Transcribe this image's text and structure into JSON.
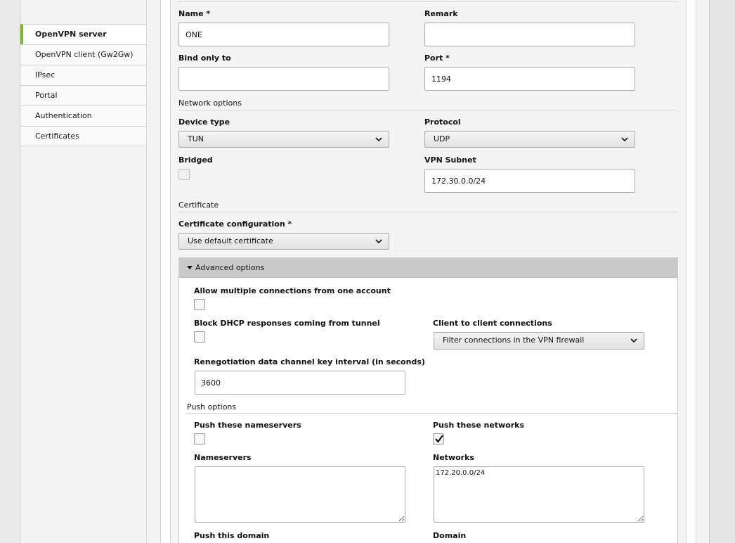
{
  "sidebar": {
    "items": [
      {
        "label": "OpenVPN server",
        "active": true
      },
      {
        "label": "OpenVPN client (Gw2Gw)",
        "active": false
      },
      {
        "label": "IPsec",
        "active": false
      },
      {
        "label": "Portal",
        "active": false
      },
      {
        "label": "Authentication",
        "active": false
      },
      {
        "label": "Certificates",
        "active": false
      }
    ]
  },
  "form": {
    "name_label": "Name *",
    "name_value": "ONE",
    "remark_label": "Remark",
    "remark_value": "",
    "bind_label": "Bind only to",
    "bind_value": "",
    "port_label": "Port *",
    "port_value": "1194",
    "network_options_title": "Network options",
    "device_type_label": "Device type",
    "device_type_value": "TUN",
    "protocol_label": "Protocol",
    "protocol_value": "UDP",
    "bridged_label": "Bridged",
    "bridged_checked": false,
    "vpn_subnet_label": "VPN Subnet",
    "vpn_subnet_value": "172.30.0.0/24",
    "certificate_title": "Certificate",
    "cert_config_label": "Certificate configuration *",
    "cert_config_value": "Use default certificate"
  },
  "advanced": {
    "title": "Advanced options",
    "allow_multi_label": "Allow multiple connections from one account",
    "allow_multi_checked": false,
    "block_dhcp_label": "Block DHCP responses coming from tunnel",
    "block_dhcp_checked": false,
    "c2c_label": "Client to client connections",
    "c2c_value": "Filter connections in the VPN firewall",
    "renegotiation_label": "Renegotiation data channel key interval (in seconds)",
    "renegotiation_value": "3600",
    "push_options_title": "Push options",
    "push_ns_label": "Push these nameservers",
    "push_ns_checked": false,
    "push_networks_label": "Push these networks",
    "push_networks_checked": true,
    "nameservers_label": "Nameservers",
    "nameservers_value": "",
    "networks_label": "Networks",
    "networks_value": "172.20.0.0/24",
    "push_domain_label": "Push this domain",
    "domain_label": "Domain"
  },
  "colors": {
    "active_accent": "#7ab929",
    "panel_bg": "#f4f4f4",
    "advanced_header_bg": "#c9c9c9"
  }
}
